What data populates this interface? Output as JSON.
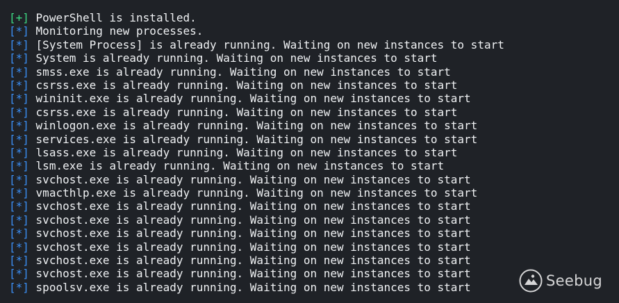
{
  "terminal": {
    "lines": [
      {
        "tag": "[+]",
        "kind": "success",
        "text": "PowerShell is installed."
      },
      {
        "tag": "[*]",
        "kind": "info",
        "text": "Monitoring new processes."
      },
      {
        "tag": "[*]",
        "kind": "info",
        "text": "[System Process] is already running. Waiting on new instances to start"
      },
      {
        "tag": "[*]",
        "kind": "info",
        "text": "System is already running. Waiting on new instances to start"
      },
      {
        "tag": "[*]",
        "kind": "info",
        "text": "smss.exe is already running. Waiting on new instances to start"
      },
      {
        "tag": "[*]",
        "kind": "info",
        "text": "csrss.exe is already running. Waiting on new instances to start"
      },
      {
        "tag": "[*]",
        "kind": "info",
        "text": "wininit.exe is already running. Waiting on new instances to start"
      },
      {
        "tag": "[*]",
        "kind": "info",
        "text": "csrss.exe is already running. Waiting on new instances to start"
      },
      {
        "tag": "[*]",
        "kind": "info",
        "text": "winlogon.exe is already running. Waiting on new instances to start"
      },
      {
        "tag": "[*]",
        "kind": "info",
        "text": "services.exe is already running. Waiting on new instances to start"
      },
      {
        "tag": "[*]",
        "kind": "info",
        "text": "lsass.exe is already running. Waiting on new instances to start"
      },
      {
        "tag": "[*]",
        "kind": "info",
        "text": "lsm.exe is already running. Waiting on new instances to start"
      },
      {
        "tag": "[*]",
        "kind": "info",
        "text": "svchost.exe is already running. Waiting on new instances to start"
      },
      {
        "tag": "[*]",
        "kind": "info",
        "text": "vmacthlp.exe is already running. Waiting on new instances to start"
      },
      {
        "tag": "[*]",
        "kind": "info",
        "text": "svchost.exe is already running. Waiting on new instances to start"
      },
      {
        "tag": "[*]",
        "kind": "info",
        "text": "svchost.exe is already running. Waiting on new instances to start"
      },
      {
        "tag": "[*]",
        "kind": "info",
        "text": "svchost.exe is already running. Waiting on new instances to start"
      },
      {
        "tag": "[*]",
        "kind": "info",
        "text": "svchost.exe is already running. Waiting on new instances to start"
      },
      {
        "tag": "[*]",
        "kind": "info",
        "text": "svchost.exe is already running. Waiting on new instances to start"
      },
      {
        "tag": "[*]",
        "kind": "info",
        "text": "svchost.exe is already running. Waiting on new instances to start"
      },
      {
        "tag": "[*]",
        "kind": "info",
        "text": "spoolsv.exe is already running. Waiting on new instances to start"
      }
    ]
  },
  "watermark": {
    "text": "Seebug",
    "icon": "seebug-logo-icon"
  },
  "colors": {
    "background": "#1f2227",
    "text": "#f0f2f4",
    "success_tag": "#3ddc84",
    "info_tag": "#3b8ff5"
  }
}
